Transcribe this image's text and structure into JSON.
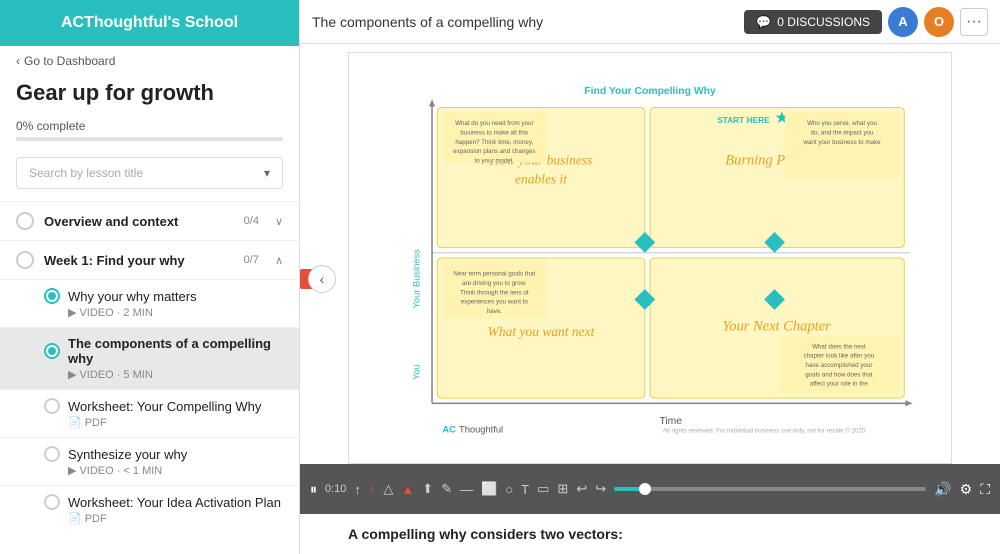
{
  "sidebar": {
    "school_name": "ACThoughtful's School",
    "back_label": "Go to Dashboard",
    "course_title": "Gear up for growth",
    "progress_pct": "0%",
    "progress_label": "0% complete",
    "progress_fill": 0,
    "search_placeholder": "Search by lesson title",
    "sections": [
      {
        "id": "overview",
        "label": "Overview and context",
        "count": "0/4",
        "expanded": false,
        "chevron": "∨"
      },
      {
        "id": "week1",
        "label": "Week 1: Find your why",
        "count": "0/7",
        "expanded": true,
        "chevron": "∧"
      }
    ],
    "lessons": [
      {
        "id": "why-matters",
        "title": "Why your why matters",
        "type": "VIDEO",
        "duration": "2 MIN",
        "active": false,
        "completed": false
      },
      {
        "id": "components",
        "title": "The components of a compelling why",
        "type": "VIDEO",
        "duration": "5 MIN",
        "active": true,
        "completed": false
      },
      {
        "id": "worksheet-compelling",
        "title": "Worksheet: Your Compelling Why",
        "type": "PDF",
        "duration": "",
        "active": false,
        "completed": false
      },
      {
        "id": "synthesize",
        "title": "Synthesize your why",
        "type": "VIDEO",
        "duration": "< 1 MIN",
        "active": false,
        "completed": false
      },
      {
        "id": "worksheet-idea",
        "title": "Worksheet: Your Idea Activation Plan",
        "type": "PDF",
        "duration": "",
        "active": false,
        "completed": false
      }
    ]
  },
  "main": {
    "lesson_title": "The components of a compelling why",
    "discussions_label": "0 DISCUSSIONS",
    "time_current": "0:10",
    "below_video_text": "A compelling why considers two vectors:"
  },
  "diagram": {
    "title": "Find Your Compelling Why",
    "start_here": "START HERE",
    "quadrants": [
      {
        "id": "q1",
        "label": "How your business enables it"
      },
      {
        "id": "q2",
        "label": "Burning Platform"
      },
      {
        "id": "q3",
        "label": "What you want next"
      },
      {
        "id": "q4",
        "label": "Your Next Chapter"
      }
    ],
    "axis_x": "Time",
    "axis_y_top": "Your Business",
    "axis_y_bottom": "You",
    "notes": [
      "Who you serve, what you do, and the impact you want your business to make",
      "What do you need from your business to make all this happen? Think time, money, expansion plans and changes to your model.",
      "Near term personal goals that are driving you to grow. Think through the lens of experiences you want to have.",
      "What does the next chapter look like after you have accomplished your goals and how does that affect your role in the business and what happens to it?"
    ]
  },
  "icons": {
    "back_arrow": "‹",
    "chevron_down": "▾",
    "play_pause": "⏸",
    "volume": "🔊",
    "fullscreen": "⛶",
    "settings": "⚙",
    "discussions_icon": "💬",
    "video_icon": "▶",
    "pdf_icon": "📄"
  },
  "users": [
    {
      "initial": "A",
      "color": "#3a7bd5"
    },
    {
      "initial": "O",
      "color": "#e67e22"
    }
  ]
}
